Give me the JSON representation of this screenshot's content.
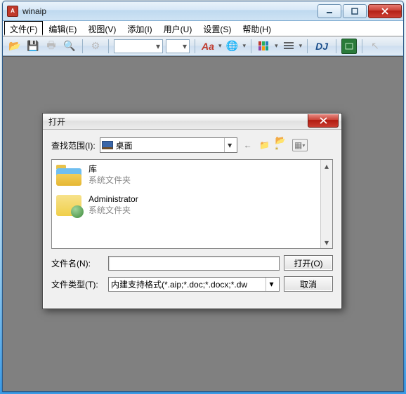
{
  "app": {
    "title": "winaip"
  },
  "menu": {
    "items": [
      {
        "label": "文件(F)"
      },
      {
        "label": "编辑(E)"
      },
      {
        "label": "视图(V)"
      },
      {
        "label": "添加(I)"
      },
      {
        "label": "用户(U)"
      },
      {
        "label": "设置(S)"
      },
      {
        "label": "帮助(H)"
      }
    ],
    "active_index": 0
  },
  "toolbar": {
    "font_style_label": "Aa",
    "dj_label": "DJ"
  },
  "dialog": {
    "title": "打开",
    "look_in_label": "查找范围(I):",
    "look_in_value": "桌面",
    "items": [
      {
        "name": "库",
        "sub": "系统文件夹"
      },
      {
        "name": "Administrator",
        "sub": "系统文件夹"
      }
    ],
    "filename_label": "文件名(N):",
    "filename_value": "",
    "filetype_label": "文件类型(T):",
    "filetype_value": "内建支持格式(*.aip;*.doc;*.docx;*.dw",
    "open_btn": "打开(O)",
    "cancel_btn": "取消"
  }
}
